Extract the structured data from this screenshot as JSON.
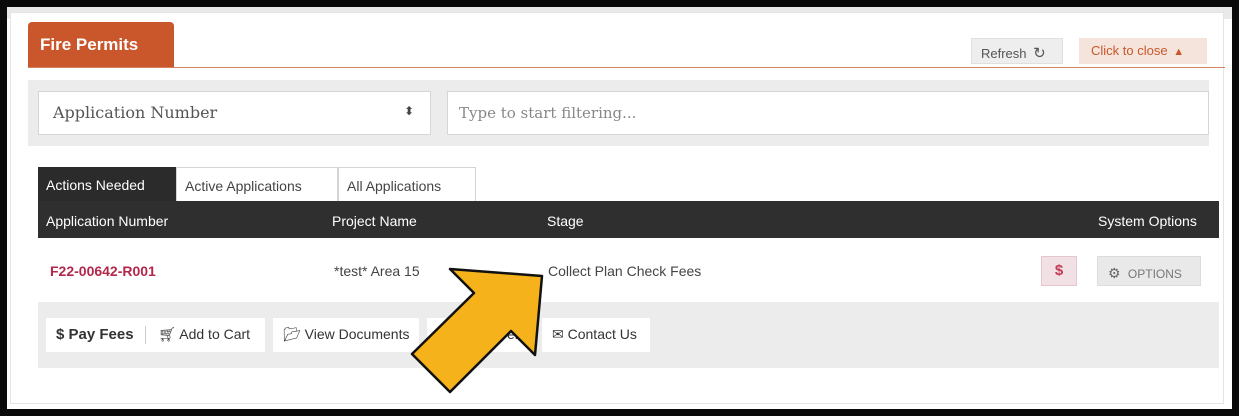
{
  "panel": {
    "title": "Fire Permits",
    "refresh_label": "Refresh",
    "close_label": "Click to close"
  },
  "filter": {
    "select_value": "Application Number",
    "input_placeholder": "Type to start filtering..."
  },
  "tabs": [
    {
      "label": "Actions Needed",
      "active": true
    },
    {
      "label": "Active Applications",
      "active": false
    },
    {
      "label": "All Applications",
      "active": false
    }
  ],
  "table": {
    "headers": [
      "Application Number",
      "Project Name",
      "Stage",
      "System Options"
    ],
    "rows": [
      {
        "application_number": "F22-00642-R001",
        "project_name": "*test* Area 15",
        "stage": "Collect Plan Check Fees",
        "pay_symbol": "$",
        "options_label": "OPTIONS"
      }
    ]
  },
  "actions": {
    "pay_fees": "$ Pay Fees",
    "add_to_cart": "Add to Cart",
    "view_documents": "View Documents",
    "partial_label": "el",
    "contact_us": "Contact Us"
  },
  "colors": {
    "brand": "#c9572b",
    "link": "#b3274a",
    "arrow_fill": "#f6b21a"
  },
  "icons": [
    "refresh-icon",
    "chevron-up-icon",
    "sort-arrows-icon",
    "gear-icon",
    "cart-icon",
    "folder-icon",
    "envelope-icon",
    "arrow-pointer-icon"
  ]
}
